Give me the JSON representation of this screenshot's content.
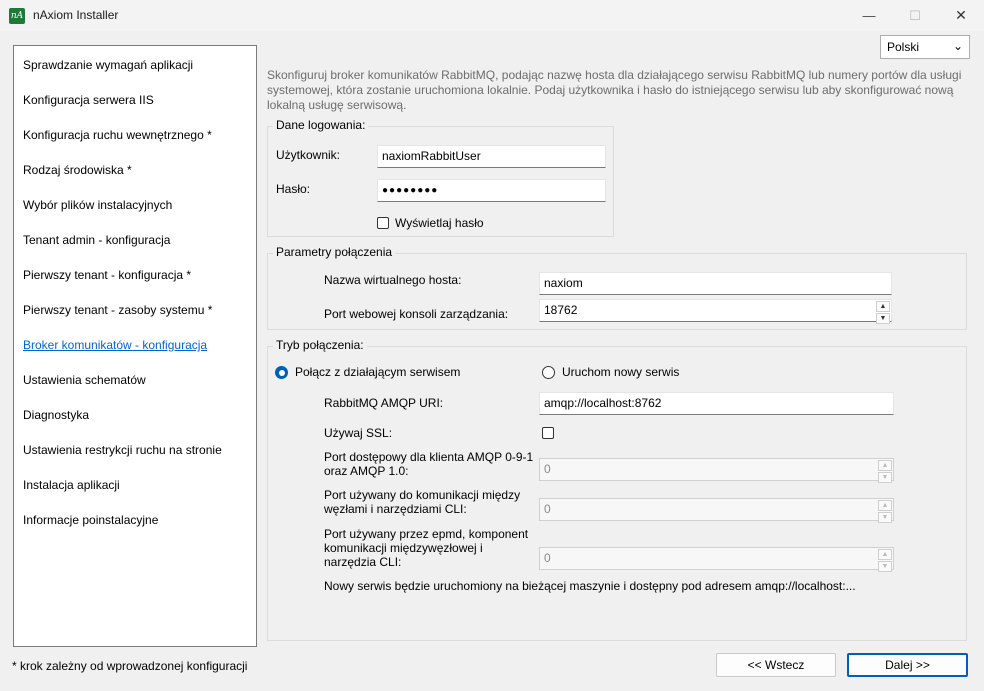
{
  "window": {
    "title": "nAxiom Installer",
    "icon_text": "nA",
    "minimize_glyph": "—",
    "maximize_glyph": "☐",
    "close_glyph": "✕"
  },
  "sidebar": {
    "items": [
      {
        "label": "Sprawdzanie wymagań aplikacji"
      },
      {
        "label": "Konfiguracja serwera IIS"
      },
      {
        "label": "Konfiguracja ruchu wewnętrznego *"
      },
      {
        "label": "Rodzaj środowiska *"
      },
      {
        "label": "Wybór plików instalacyjnych"
      },
      {
        "label": "Tenant admin - konfiguracja"
      },
      {
        "label": "Pierwszy tenant - konfiguracja *"
      },
      {
        "label": "Pierwszy tenant - zasoby systemu *"
      },
      {
        "label": "Broker komunikatów - konfiguracja",
        "active": true
      },
      {
        "label": "Ustawienia schematów"
      },
      {
        "label": "Diagnostyka"
      },
      {
        "label": "Ustawienia restrykcji ruchu na stronie"
      },
      {
        "label": "Instalacja aplikacji"
      },
      {
        "label": "Informacje poinstalacyjne"
      }
    ],
    "footnote": "* krok zależny od wprowadzonej konfiguracji"
  },
  "language": {
    "selected": "Polski",
    "chevron": "⌄"
  },
  "description": "Skonfiguruj broker komunikatów RabbitMQ, podając nazwę hosta dla działającego serwisu RabbitMQ lub numery portów dla usługi systemowej, która zostanie uruchomiona lokalnie. Podaj użytkownika i hasło do istniejącego serwisu lub aby skonfigurować nową lokalną usługę serwisową.",
  "login": {
    "legend": "Dane logowania:",
    "user_label": "Użytkownik:",
    "user_value": "naxiomRabbitUser",
    "password_label": "Hasło:",
    "password_value": "●●●●●●●●",
    "show_password_label": "Wyświetlaj hasło",
    "show_password_checked": false
  },
  "connection_params": {
    "legend": "Parametry połączenia",
    "vhost_label": "Nazwa wirtualnego hosta:",
    "vhost_value": "naxiom",
    "console_port_label": "Port webowej konsoli zarządzania:",
    "console_port_value": "18762"
  },
  "connection_mode": {
    "legend": "Tryb połączenia:",
    "option_existing": "Połącz z działającym serwisem",
    "option_new": "Uruchom nowy serwis",
    "selected": "existing",
    "uri_label": "RabbitMQ AMQP URI:",
    "uri_value": "amqp://localhost:8762",
    "ssl_label": "Używaj SSL:",
    "ssl_checked": false,
    "amqp_port_label_1": "Port dostępowy dla klienta AMQP 0-9-1",
    "amqp_port_label_2": "oraz AMQP 1.0:",
    "amqp_port_value": "0",
    "node_port_label_1": "Port używany do komunikacji między",
    "node_port_label_2": "węzłami i narzędziami CLI:",
    "node_port_value": "0",
    "epmd_port_label_1": "Port używany przez epmd, komponent",
    "epmd_port_label_2": "komunikacji międzywęzłowej i",
    "epmd_port_label_3": "narzędzia CLI:",
    "epmd_port_value": "0",
    "info": "Nowy serwis będzie uruchomiony na bieżącej maszynie i dostępny pod adresem amqp://localhost:..."
  },
  "buttons": {
    "back": "<< Wstecz",
    "next": "Dalej >>"
  },
  "colors": {
    "accent": "#005fb8",
    "active_link": "#0066cc",
    "app_icon": "#1f7a3a"
  }
}
